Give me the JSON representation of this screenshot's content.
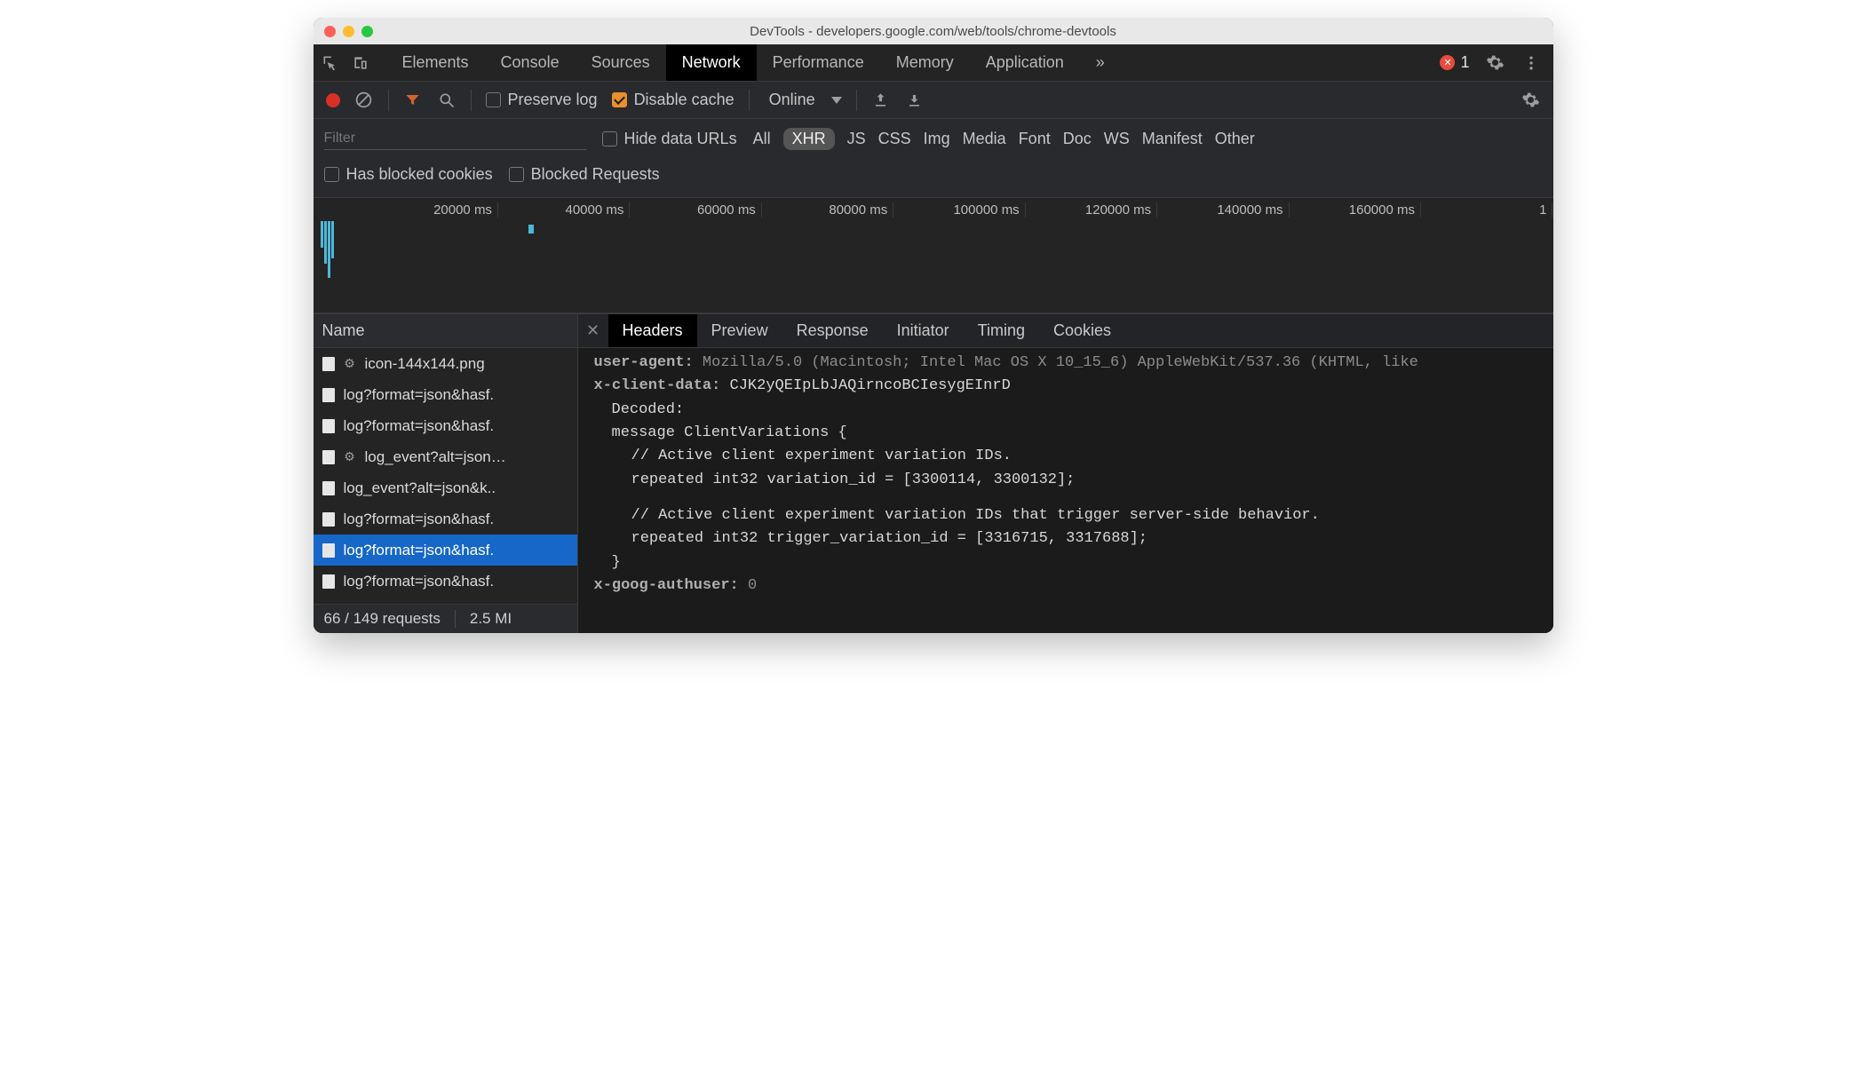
{
  "window": {
    "title": "DevTools - developers.google.com/web/tools/chrome-devtools"
  },
  "tabs": {
    "items": [
      "Elements",
      "Console",
      "Sources",
      "Network",
      "Performance",
      "Memory",
      "Application"
    ],
    "active": "Network",
    "overflow": "»",
    "error_count": "1"
  },
  "toolbar": {
    "preserve_log": "Preserve log",
    "disable_cache": "Disable cache",
    "throttle": "Online"
  },
  "filterbar": {
    "placeholder": "Filter",
    "hide_data_urls": "Hide data URLs",
    "types": [
      "All",
      "XHR",
      "JS",
      "CSS",
      "Img",
      "Media",
      "Font",
      "Doc",
      "WS",
      "Manifest",
      "Other"
    ],
    "selected_type": "XHR",
    "has_blocked_cookies": "Has blocked cookies",
    "blocked_requests": "Blocked Requests"
  },
  "timeline": {
    "ticks": [
      "20000 ms",
      "40000 ms",
      "60000 ms",
      "80000 ms",
      "100000 ms",
      "120000 ms",
      "140000 ms",
      "160000 ms",
      "1"
    ]
  },
  "requests": {
    "header": "Name",
    "rows": [
      {
        "name": "icon-144x144.png",
        "gear": true
      },
      {
        "name": "log?format=json&hasf."
      },
      {
        "name": "log?format=json&hasf."
      },
      {
        "name": "log_event?alt=json…",
        "gear": true
      },
      {
        "name": "log_event?alt=json&k.."
      },
      {
        "name": "log?format=json&hasf."
      },
      {
        "name": "log?format=json&hasf.",
        "selected": true
      },
      {
        "name": "log?format=json&hasf."
      }
    ],
    "footer": {
      "count": "66 / 149 requests",
      "transfer": "2.5 MI"
    }
  },
  "detail": {
    "tabs": [
      "Headers",
      "Preview",
      "Response",
      "Initiator",
      "Timing",
      "Cookies"
    ],
    "active": "Headers",
    "lines": {
      "ua_key": "user-agent:",
      "ua_val": "Mozilla/5.0 (Macintosh; Intel Mac OS X 10_15_6) AppleWebKit/537.36 (KHTML, like",
      "xcd_key": "x-client-data:",
      "xcd_val": "CJK2yQEIpLbJAQirncoBCIesygEInrD",
      "decoded": "Decoded:",
      "msg_open": "message ClientVariations {",
      "c1": "// Active client experiment variation IDs.",
      "l1": "repeated int32 variation_id = [3300114, 3300132];",
      "c2": "// Active client experiment variation IDs that trigger server-side behavior.",
      "l2": "repeated int32 trigger_variation_id = [3316715, 3317688];",
      "msg_close": "}",
      "xga_key": "x-goog-authuser:",
      "xga_val": "0"
    }
  }
}
